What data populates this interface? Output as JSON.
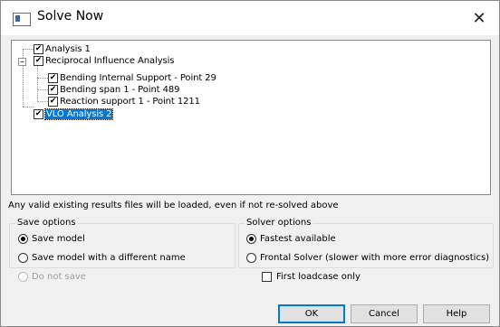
{
  "window": {
    "title": "Solve Now",
    "close_glyph": "✕"
  },
  "tree": {
    "nodes": [
      {
        "label": "Analysis 1",
        "checked": true
      },
      {
        "label": "Reciprocal Influence Analysis",
        "checked": true,
        "expanded": true
      },
      {
        "label": "Bending Internal Support - Point 29",
        "checked": true
      },
      {
        "label": "Bending span 1 - Point 489",
        "checked": true
      },
      {
        "label": "Reaction support 1 - Point 1211",
        "checked": true
      },
      {
        "label": "VLO Analysis 2",
        "checked": true,
        "selected": true
      }
    ],
    "check_glyph": "☑",
    "collapse_glyph": "−"
  },
  "note": "Any valid existing results files will be loaded, even if not re-solved above",
  "save_options": {
    "title": "Save options",
    "options": [
      {
        "label": "Save model",
        "selected": true
      },
      {
        "label": "Save model with a different name",
        "selected": false
      },
      {
        "label": "Do not save",
        "selected": false,
        "disabled": true
      }
    ]
  },
  "solver_options": {
    "title": "Solver options",
    "options": [
      {
        "label": "Fastest available",
        "selected": true
      },
      {
        "label": "Frontal Solver (slower with more error diagnostics)",
        "selected": false
      }
    ],
    "first_loadcase_label": "First loadcase only",
    "first_loadcase_checked": false
  },
  "buttons": {
    "ok": "OK",
    "cancel": "Cancel",
    "help": "Help"
  },
  "colors": {
    "selection": "#0078d7",
    "dialog_bg": "#f0f0f0"
  }
}
